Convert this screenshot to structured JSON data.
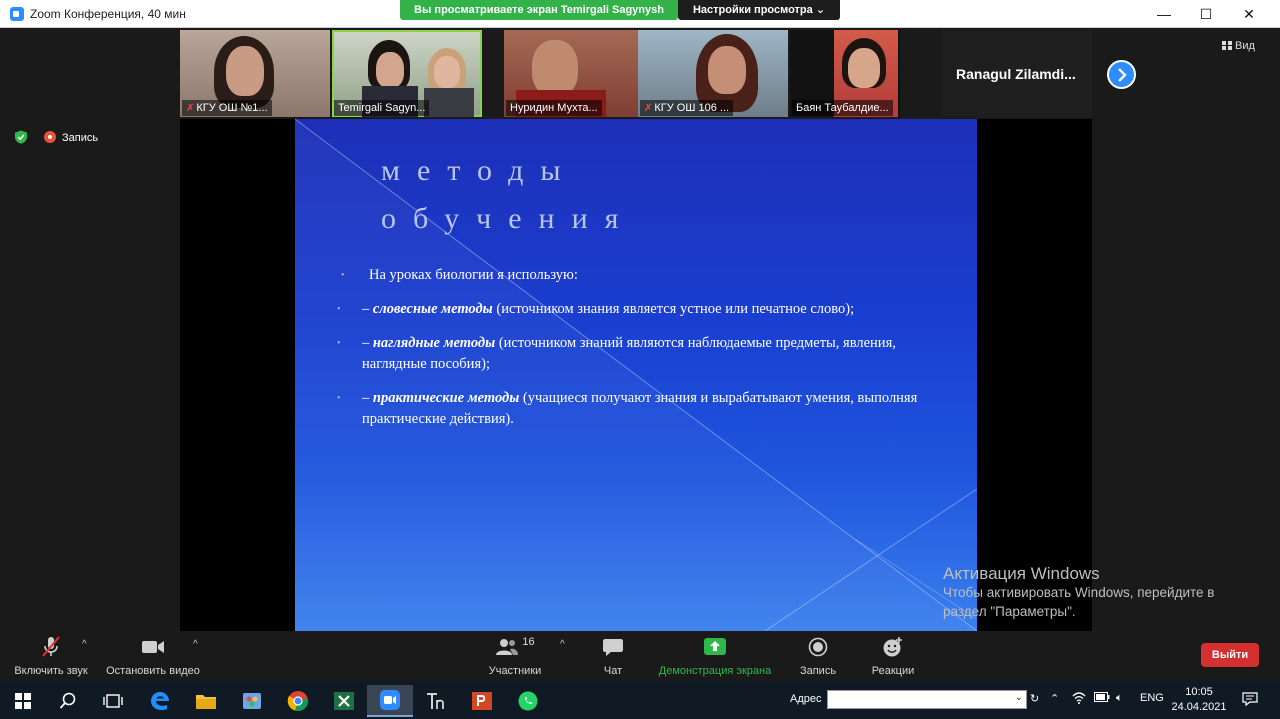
{
  "window": {
    "title": "Zoom Конференция, 40 мин",
    "minimize": "—",
    "maximize": "☐",
    "close": "✕"
  },
  "share_banner": {
    "text": "Вы просматриваете экран Temirgali Sagynysh",
    "view_options": "Настройки просмотра ⌄"
  },
  "participants": [
    {
      "name": "КГУ ОШ №1...",
      "muted": true
    },
    {
      "name": "Temirgali Sagyn...",
      "muted": false
    },
    {
      "name": "Нуридин Мухта...",
      "muted": false
    },
    {
      "name": "КГУ ОШ 106 ...",
      "muted": true
    },
    {
      "name": "Баян Таубалдие...",
      "muted": false
    },
    {
      "name": "Ranagul  Zilamdi...",
      "muted": false
    }
  ],
  "view_button": "Вид",
  "recording_indicator": "Запись",
  "slide": {
    "title_line1": "методы",
    "title_line2": "обучения",
    "intro": "На уроках биологии я использую:",
    "items": [
      {
        "prefix": "– ",
        "term": "словесные методы",
        "text": " (источником знания является устное или печатное слово);"
      },
      {
        "prefix": "– ",
        "term": "наглядные методы",
        "text": " (источником знаний являются наблюдаемые предметы, явления, наглядные пособия);"
      },
      {
        "prefix": "– ",
        "term": "практические методы",
        "text": " (учащиеся получают знания и вырабатывают умения, выполняя практические действия)."
      }
    ],
    "bullet_glyph": "•"
  },
  "watermark": {
    "line1": "Активация Windows",
    "line2": "Чтобы активировать Windows, перейдите в",
    "line3": "раздел \"Параметры\"."
  },
  "toolbar": {
    "unmute": "Включить звук",
    "stop_video": "Остановить видео",
    "participants": "Участники",
    "participants_count": "16",
    "chat": "Чат",
    "share_screen": "Демонстрация экрана",
    "record": "Запись",
    "reactions": "Реакции",
    "leave": "Выйти",
    "caret": "^"
  },
  "taskbar": {
    "address_label": "Адрес",
    "address_value": "",
    "language": "ENG",
    "time": "10:05",
    "date": "24.04.2021"
  },
  "colors": {
    "share_banner": "#33b24a",
    "zoom_blue": "#2d8cff",
    "leave_red": "#d3302f",
    "slide_blue": "#1a3fd0"
  }
}
